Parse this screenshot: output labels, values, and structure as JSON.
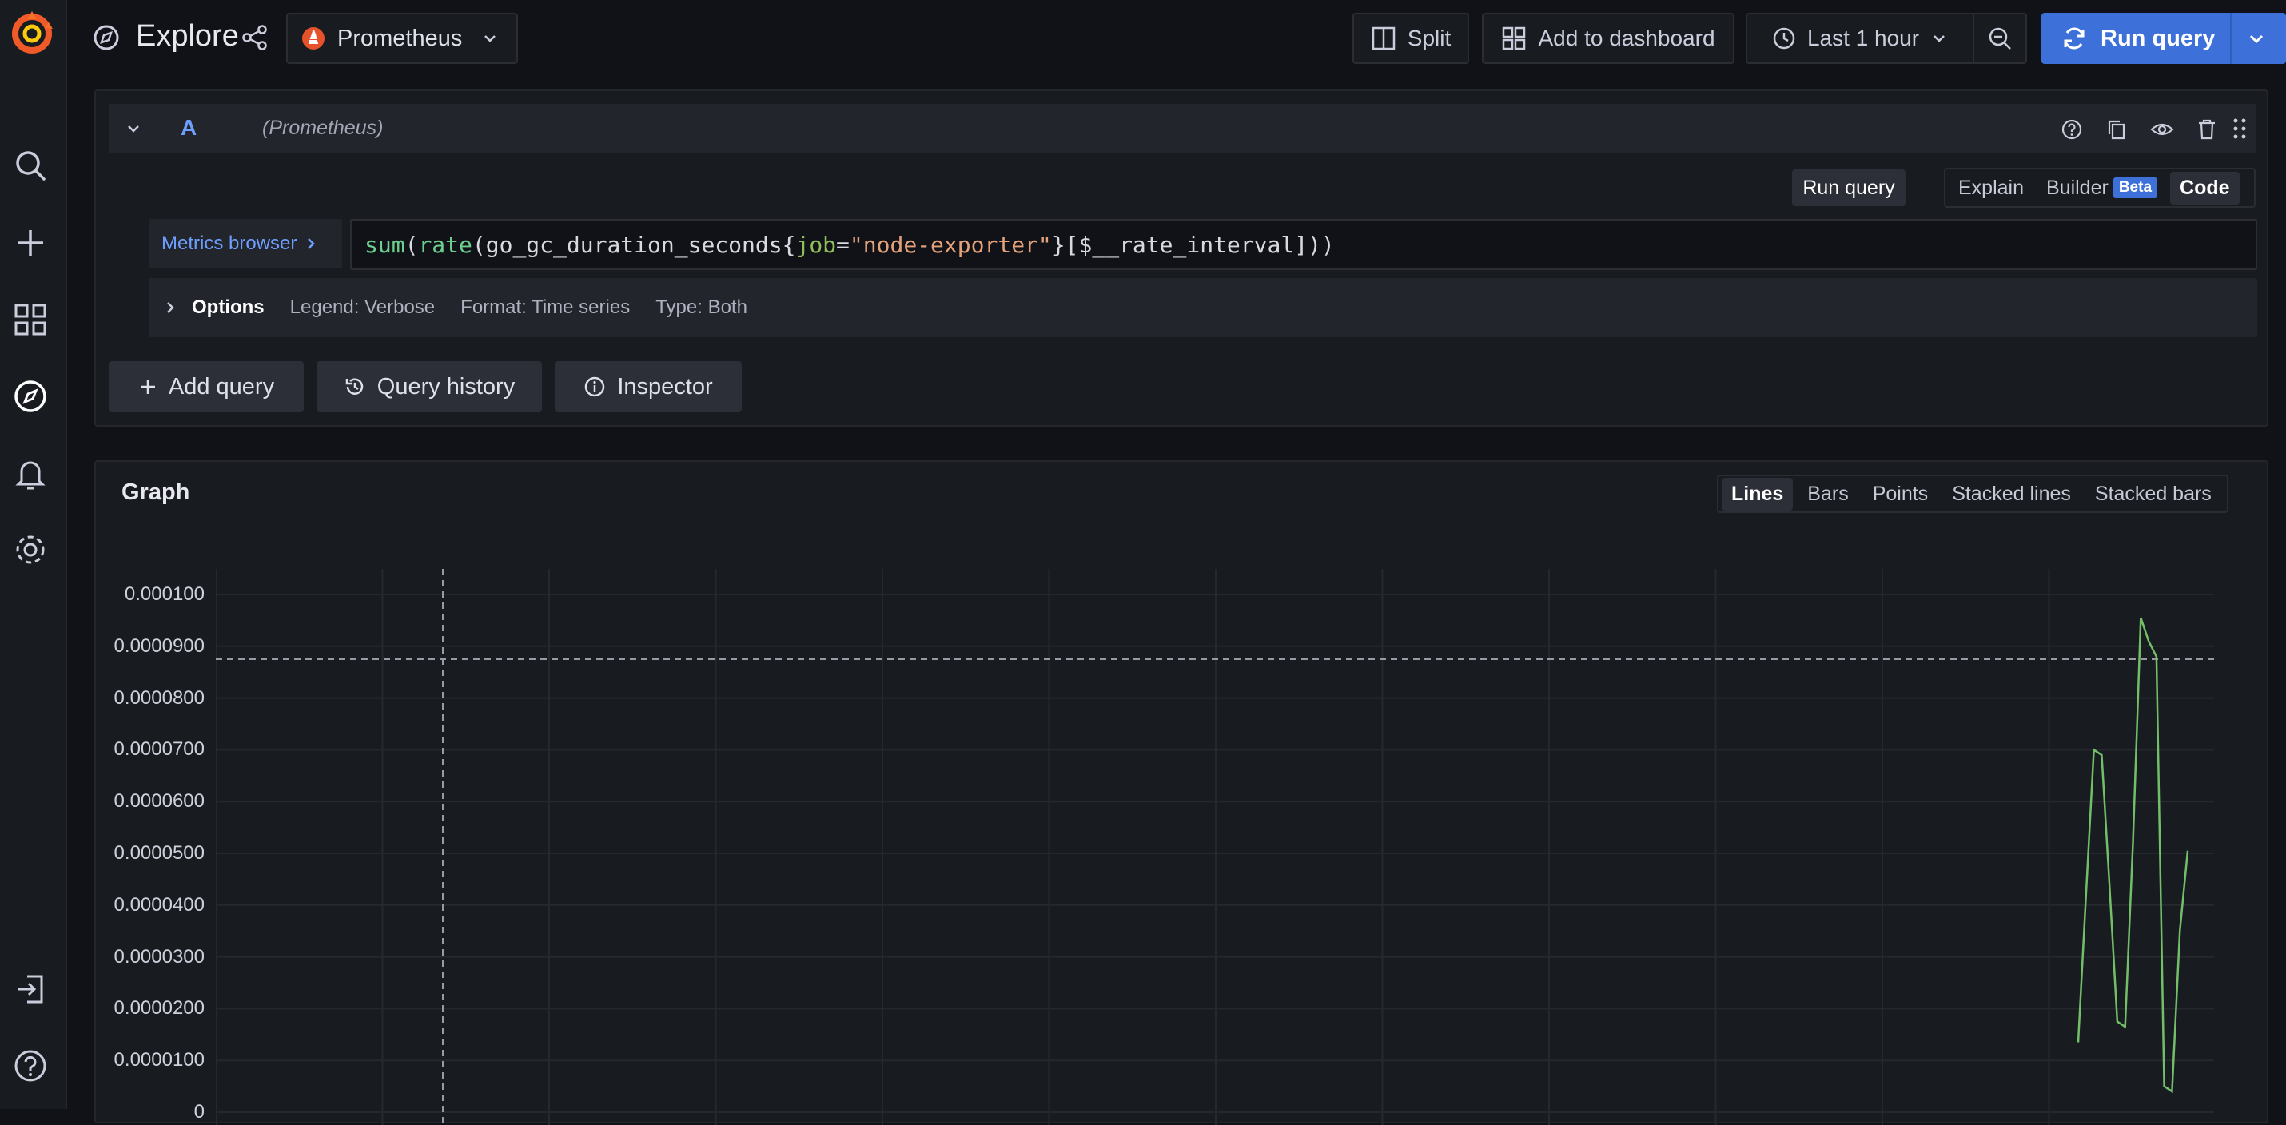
{
  "header": {
    "title": "Explore",
    "datasource": "Prometheus",
    "split_label": "Split",
    "add_to_dashboard_label": "Add to dashboard",
    "time_range": "Last 1 hour",
    "run_query_label": "Run query"
  },
  "sidebar": {
    "items": [
      {
        "icon": "search-icon"
      },
      {
        "icon": "plus-icon"
      },
      {
        "icon": "dashboards-icon"
      },
      {
        "icon": "compass-icon"
      },
      {
        "icon": "bell-icon"
      },
      {
        "icon": "gear-icon"
      }
    ],
    "bottom": [
      {
        "icon": "sign-in-icon"
      },
      {
        "icon": "help-icon"
      }
    ]
  },
  "query": {
    "ref_id": "A",
    "datasource_label": "(Prometheus)",
    "run_query_label": "Run query",
    "modes": {
      "explain": "Explain",
      "builder": "Builder",
      "beta": "Beta",
      "code": "Code"
    },
    "metrics_browser_label": "Metrics browser",
    "expr": {
      "fn1": "sum",
      "p1": "(",
      "fn2": "rate",
      "p2": "(",
      "metric": "go_gc_duration_seconds",
      "b1": "{",
      "label": "job",
      "eq": "=",
      "value": "\"node-exporter\"",
      "b2": "}",
      "range": "[$__rate_interval]",
      "close": "))"
    },
    "options": {
      "label": "Options",
      "legend": "Legend: Verbose",
      "format": "Format: Time series",
      "type": "Type: Both"
    }
  },
  "actions": {
    "add_query": "Add query",
    "query_history": "Query history",
    "inspector": "Inspector"
  },
  "graph": {
    "title": "Graph",
    "view_modes": [
      "Lines",
      "Bars",
      "Points",
      "Stacked lines",
      "Stacked bars"
    ],
    "active_mode": "Lines"
  },
  "chart_data": {
    "type": "line",
    "title": "Graph",
    "series_color": "#73bf69",
    "y_ticks": [
      "0.000100",
      "0.0000900",
      "0.0000800",
      "0.0000700",
      "0.0000600",
      "0.0000500",
      "0.0000400",
      "0.0000300",
      "0.0000200",
      "0.0000100",
      "0"
    ],
    "ylim": [
      0,
      0.0001
    ],
    "threshold_line": 8.75e-05,
    "series": [
      {
        "values": [
          1.35e-05,
          4.2e-05,
          7e-05,
          6.9e-05,
          4.4e-05,
          1.75e-05,
          1.65e-05,
          5.2e-05,
          9.55e-05,
          9.1e-05,
          8.8e-05,
          5e-06,
          4e-06,
          3.5e-05,
          5.05e-05
        ]
      }
    ],
    "grid": true
  },
  "colors": {
    "accent": "#3d71d9",
    "series": "#73bf69",
    "logo": "#f05a28"
  }
}
